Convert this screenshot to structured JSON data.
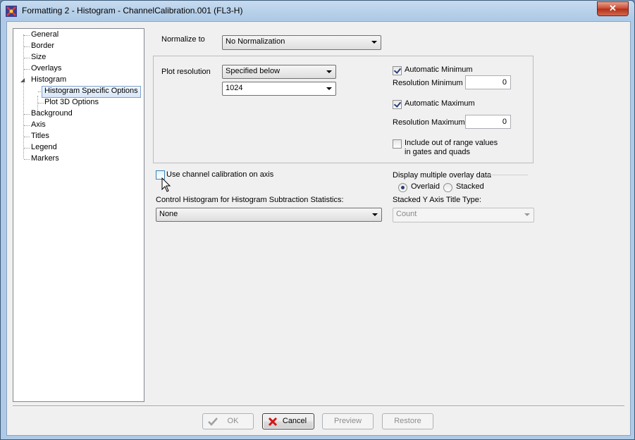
{
  "window": {
    "title": "Formatting 2 - Histogram - ChannelCalibration.001 (FL3-H)",
    "close_label": "✕"
  },
  "tree": {
    "items": [
      {
        "label": "General"
      },
      {
        "label": "Border"
      },
      {
        "label": "Size"
      },
      {
        "label": "Overlays"
      },
      {
        "label": "Histogram"
      },
      {
        "label": "Histogram Specific Options"
      },
      {
        "label": "Plot 3D Options"
      },
      {
        "label": "Background"
      },
      {
        "label": "Axis"
      },
      {
        "label": "Titles"
      },
      {
        "label": "Legend"
      },
      {
        "label": "Markers"
      }
    ],
    "expander": "◢"
  },
  "normalize": {
    "label": "Normalize to",
    "value": "No Normalization"
  },
  "plot_resolution": {
    "label": "Plot resolution",
    "mode_value": "Specified below",
    "size_value": "1024"
  },
  "auto_min": {
    "label": "Automatic Minimum",
    "checked": true
  },
  "res_min": {
    "label": "Resolution Minimum",
    "value": "0"
  },
  "auto_max": {
    "label": "Automatic Maximum",
    "checked": true
  },
  "res_max": {
    "label": "Resolution Maximum",
    "value": "0"
  },
  "out_of_range": {
    "label_line1": "Include out of range values",
    "label_line2": "in gates and quads",
    "checked": false
  },
  "channel_calibration": {
    "label": "Use channel calibration on axis",
    "checked": false
  },
  "overlay": {
    "label": "Display multiple overlay data",
    "options": [
      "Overlaid",
      "Stacked"
    ],
    "selected": "Overlaid"
  },
  "control_histogram": {
    "label": "Control Histogram for Histogram Subtraction Statistics:",
    "value": "None"
  },
  "stacked_title": {
    "label": "Stacked Y Axis Title Type:",
    "value": "Count"
  },
  "buttons": {
    "ok": "OK",
    "cancel": "Cancel",
    "preview": "Preview",
    "restore": "Restore"
  },
  "colors": {
    "title_bar": "#aecae6",
    "close_button": "#c7462d",
    "selection": "#d6e6f8",
    "checkmark": "#2b3e7a"
  }
}
